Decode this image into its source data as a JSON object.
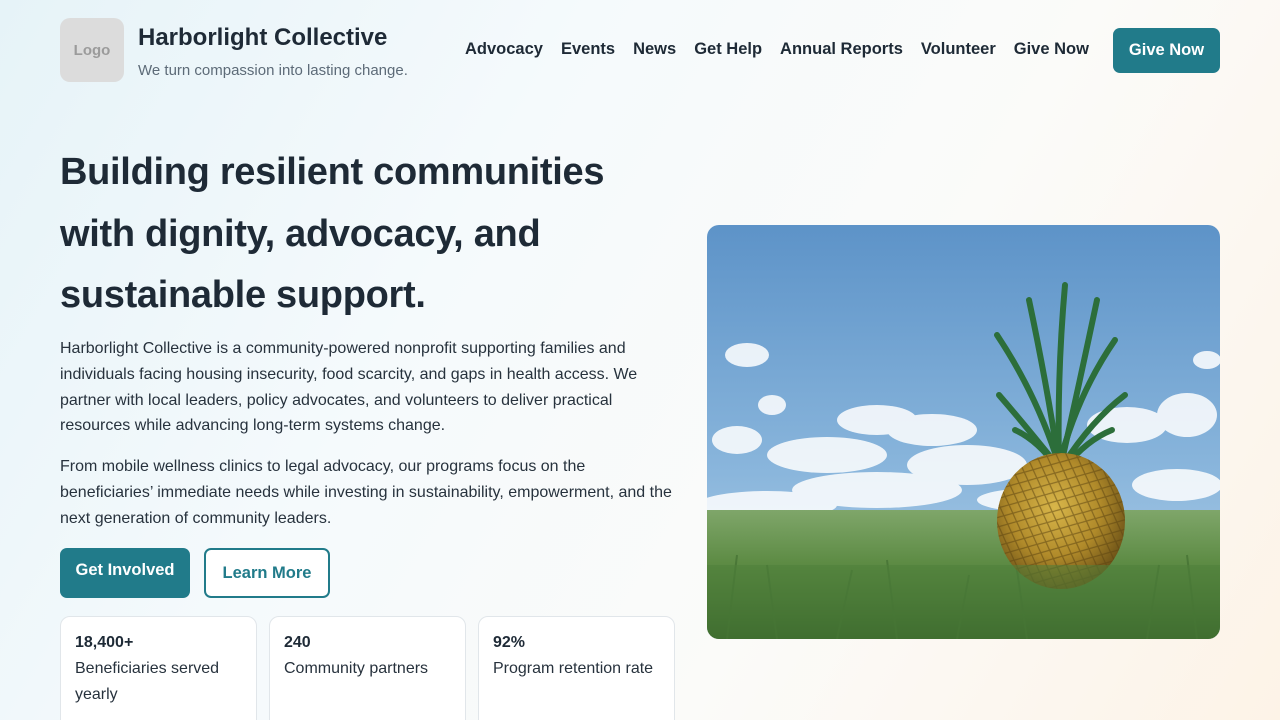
{
  "header": {
    "logo_text": "Logo",
    "brand_name": "Harborlight Collective",
    "tagline": "We turn compassion into lasting change.",
    "nav": [
      "Advocacy",
      "Events",
      "News",
      "Get Help",
      "Annual Reports",
      "Volunteer",
      "Give Now"
    ],
    "cta_label": "Give Now"
  },
  "hero": {
    "headline": "Building resilient communities with dignity, advocacy, and sustainable support.",
    "paragraph_1": "Harborlight Collective is a community-powered nonprofit supporting families and individuals facing housing insecurity, food scarcity, and gaps in health access. We partner with local leaders, policy advocates, and volunteers to deliver practical resources while advancing long-term systems change.",
    "paragraph_2": "From mobile wellness clinics to legal advocacy, our programs focus on the beneficiaries’ immediate needs while investing in sustainability, empowerment, and the next generation of community leaders.",
    "primary_button": "Get Involved",
    "secondary_button": "Learn More",
    "image": "pineapple-in-grass-photo"
  },
  "stats": [
    {
      "value": "18,400+",
      "label": "Beneficiaries served yearly"
    },
    {
      "value": "240",
      "label": "Community partners"
    },
    {
      "value": "92%",
      "label": "Program retention rate"
    }
  ],
  "colors": {
    "accent": "#217b8a",
    "text": "#1e2a36"
  }
}
